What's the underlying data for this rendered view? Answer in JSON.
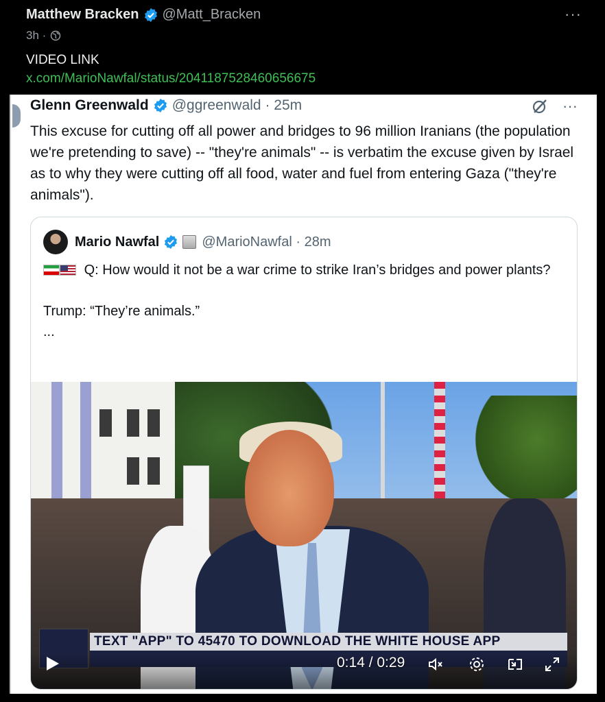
{
  "outer_post": {
    "author_name": "Matthew Bracken",
    "author_handle": "@Matt_Bracken",
    "time": "3h ·",
    "text_line1": "VIDEO LINK",
    "link": "x.com/MarioNawfal/status/2041187528460656675",
    "more": "···"
  },
  "glenn_post": {
    "author_name": "Glenn Greenwald",
    "author_handle": "@ggreenwald · 25m",
    "more": "···",
    "text": "This excuse for cutting off all power and bridges to 96 million Iranians (the population we're pretending to save) -- \"they're animals\" -- is verbatim the excuse given by Israel as to why they were cutting off all food, water and fuel from entering Gaza (\"they're animals\")."
  },
  "quoted_post": {
    "author_name": "Mario Nawfal",
    "author_handle": "@MarioNawfal · 28m",
    "line1": "Q: How would it not be a war crime to strike Iran’s bridges and power plants?",
    "line2": "Trump: “They’re animals.”",
    "line3": "..."
  },
  "video": {
    "banner_text": "TEXT \"APP\" TO 45470 TO DOWNLOAD THE WHITE HOUSE APP",
    "time": "0:14 / 0:29"
  },
  "colors": {
    "link_green": "#3fbf55",
    "verified_blue": "#1d9bf0"
  }
}
